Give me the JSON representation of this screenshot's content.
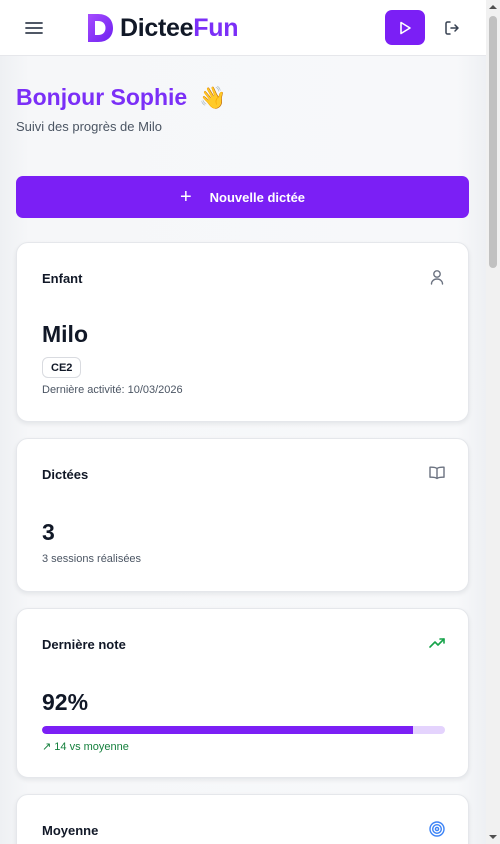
{
  "header": {
    "logo": {
      "part1": "Dictee",
      "part2": "Fun"
    },
    "icons": {
      "menu": "menu-icon",
      "play": "play-icon",
      "logout": "logout-icon"
    },
    "colors": {
      "brand": "#7b1ff5",
      "brand_text": "#7b2ff7"
    }
  },
  "greeting": {
    "title": "Bonjour Sophie",
    "emoji": "👋",
    "subtitle": "Suivi des progrès de Milo"
  },
  "actions": {
    "new_dictation": {
      "icon": "+",
      "label": "Nouvelle dictée"
    }
  },
  "cards": {
    "child": {
      "title": "Enfant",
      "icon": "user-icon",
      "name": "Milo",
      "grade": "CE2",
      "last_activity": "Dernière activité: 10/03/2026"
    },
    "dictations": {
      "title": "Dictées",
      "icon": "book-open-icon",
      "count": "3",
      "caption": "3 sessions réalisées"
    },
    "last_score": {
      "title": "Dernière note",
      "icon": "trending-up-icon",
      "value": "92%",
      "progress_percent": 92,
      "trend": "↗ 14 vs moyenne",
      "trend_color": "#15803d"
    },
    "average": {
      "title": "Moyenne",
      "icon": "target-icon"
    }
  }
}
